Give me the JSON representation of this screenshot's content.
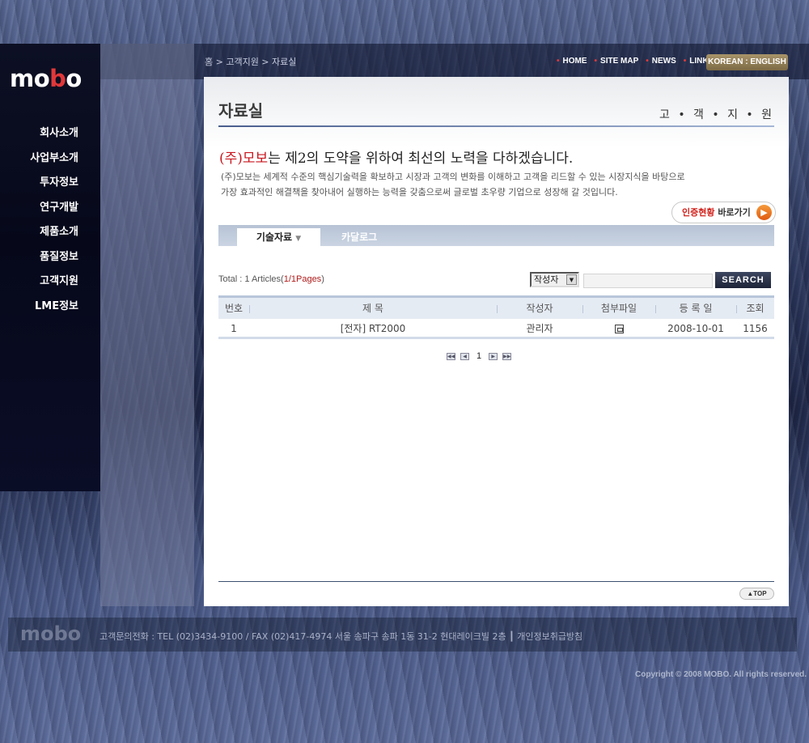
{
  "brand": {
    "logo_prefix": "mo",
    "logo_dot": "b",
    "logo_suffix": "o"
  },
  "breadcrumb": "홈 > 고객지원 > 자료실",
  "top_nav": [
    {
      "label": "HOME"
    },
    {
      "label": "SITE MAP"
    },
    {
      "label": "NEWS"
    },
    {
      "label": "LINK"
    }
  ],
  "lang_label": "KOREAN : ENGLISH",
  "left_nav": [
    {
      "label": "회사소개"
    },
    {
      "label": "사업부소개"
    },
    {
      "label": "투자정보"
    },
    {
      "label": "연구개발"
    },
    {
      "label": "제품소개"
    },
    {
      "label": "품질정보"
    },
    {
      "label": "고객지원"
    },
    {
      "label": "LME정보"
    }
  ],
  "page_title": "자료실",
  "section_title": "고 • 객 • 지 • 원",
  "slogan": {
    "company": "(주)모보",
    "rest": "는 제2의 도약을 위하여 최선의 노력을 다하겠습니다."
  },
  "description": [
    "(주)모보는 세계적 수준의 핵심기술력을 확보하고 시장과 고객의 변화를 이해하고 고객을 리드할 수 있는 시장지식을 바탕으로",
    "가장 효과적인 해결책을 찾아내어 실행하는 능력을 갖춤으로써 글로벌 초우량 기업으로 성장해 갈 것입니다."
  ],
  "cert_button": {
    "highlight": "인증현황",
    "rest": " 바로가기"
  },
  "tabs": [
    {
      "label": "기술자료",
      "active": true
    },
    {
      "label": "카달로그",
      "active": false
    }
  ],
  "list_summary": {
    "prefix": "Total : 1 Articles(",
    "pages": "1/1Pages",
    "suffix": ")"
  },
  "search": {
    "select_value": "작성자",
    "input_value": "",
    "button_label": "SEARCH"
  },
  "table": {
    "columns": [
      "번호",
      "제 목",
      "작성자",
      "첨부파일",
      "등 록 일",
      "조회"
    ],
    "rows": [
      {
        "no": "1",
        "title": "[전자] RT2000",
        "author": "관리자",
        "date": "2008-10-01",
        "views": "1156"
      }
    ]
  },
  "pagination": {
    "current": "1"
  },
  "top_button": "▲TOP",
  "footer": {
    "logo": "mobo",
    "info": "고객문의전화 : TEL (02)3434-9100 / FAX (02)417-4974 서울 송파구 송파 1동 31-2 현대레이크빌 2층 ┃ 개인정보취급방침",
    "copyright": "Copyright © 2008 MOBO. All rights reserved."
  }
}
